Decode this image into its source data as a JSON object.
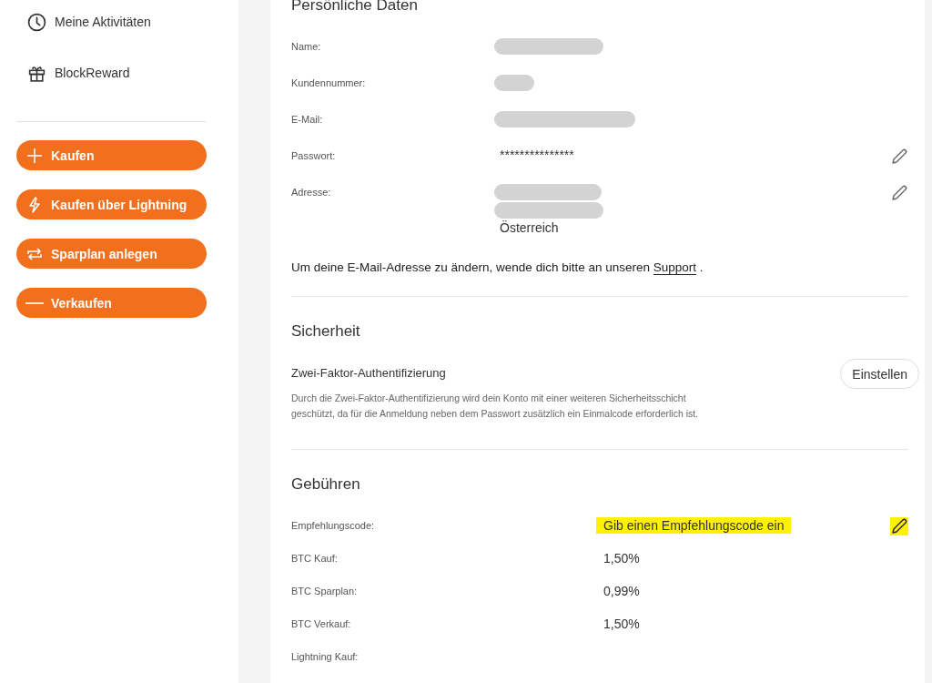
{
  "sidebar": {
    "nav_items": [
      {
        "label": "Meine Aktivitäten"
      },
      {
        "label": "BlockReward"
      }
    ],
    "actions": [
      {
        "label": "Kaufen"
      },
      {
        "label": "Kaufen über Lightning"
      },
      {
        "label": "Sparplan anlegen"
      },
      {
        "label": "Verkaufen"
      }
    ]
  },
  "personal": {
    "title": "Persönliche Daten",
    "fields": [
      {
        "label": "Name:",
        "editable": false,
        "lines": [
          {
            "redacted": true
          }
        ]
      },
      {
        "label": "Kundennummer:",
        "editable": false,
        "lines": [
          {
            "redacted": true
          }
        ]
      },
      {
        "label": "E-Mail:",
        "editable": false,
        "lines": [
          {
            "redacted": true
          }
        ]
      },
      {
        "label": "Passwort:",
        "editable": true,
        "lines": [
          {
            "redacted": false,
            "text": "***************"
          }
        ]
      },
      {
        "label": "Adresse:",
        "editable": true,
        "lines": [
          {
            "redacted": true
          },
          {
            "redacted": true
          },
          {
            "redacted": false,
            "text": "Österreich"
          }
        ]
      }
    ],
    "note": "Um deine E-Mail-Adresse zu ändern, wende dich bitte an unseren",
    "note_link": "Support",
    "note_end": "."
  },
  "security": {
    "title": "Sicherheit",
    "item_title": "Zwei-Faktor-Authentifizierung",
    "description": "Durch die Zwei-Faktor-Authentifizierung wird dein Konto mit einer weiteren Sicherheitsschicht geschützt, da für die Anmeldung neben dem Passwort zusätzlich ein Einmalcode erforderlich ist.",
    "button": "Einstellen"
  },
  "fees": {
    "title": "Gebühren",
    "rows": [
      {
        "label": "Empfehlungscode:",
        "value": "Gib einen Empfehlungscode ein",
        "highlighted": true,
        "editable": true
      },
      {
        "label": "BTC Kauf:",
        "value": "1,50%",
        "highlighted": false,
        "editable": false
      },
      {
        "label": "BTC Sparplan:",
        "value": "0,99%",
        "highlighted": false,
        "editable": false
      },
      {
        "label": "BTC Verkauf:",
        "value": "1,50%",
        "highlighted": false,
        "editable": false
      },
      {
        "label": "Lightning Kauf:"
      }
    ]
  }
}
